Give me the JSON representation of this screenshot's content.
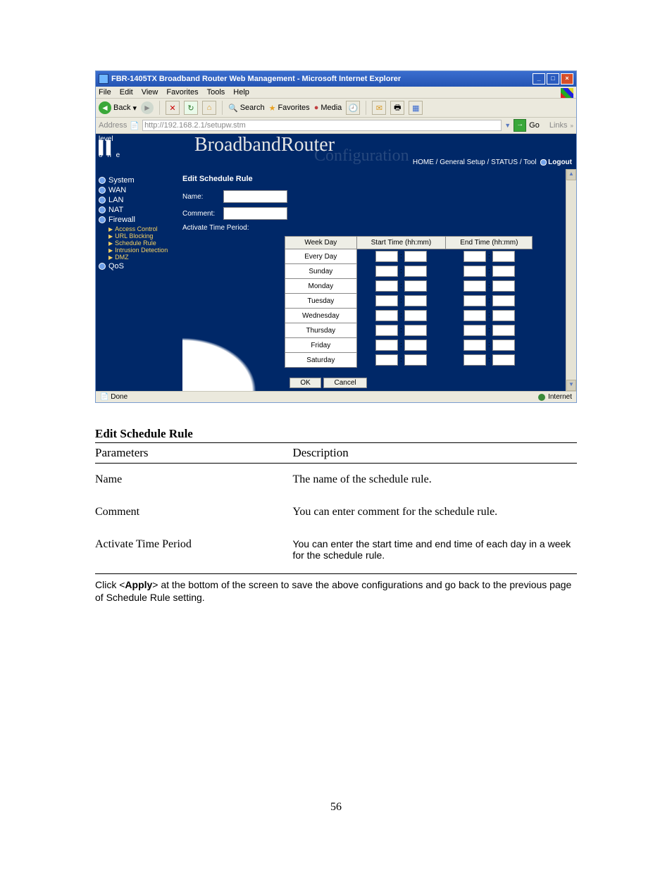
{
  "ie": {
    "title": "FBR-1405TX Broadband Router Web Management - Microsoft Internet Explorer",
    "menu": {
      "file": "File",
      "edit": "Edit",
      "view": "View",
      "favorites": "Favorites",
      "tools": "Tools",
      "help": "Help"
    },
    "toolbar": {
      "back": "Back",
      "search": "Search",
      "favorites": "Favorites",
      "media": "Media"
    },
    "address_label": "Address",
    "url": "http://192.168.2.1/setupw.stm",
    "go": "Go",
    "links": "Links",
    "status": "Done",
    "zone": "Internet"
  },
  "router": {
    "logo": {
      "level": "level",
      "one": "o n e"
    },
    "title_main": "BroadbandRouter",
    "title_sub": "Configuration",
    "top_links": {
      "home": "HOME",
      "general": "General Setup",
      "status": "STATUS",
      "tool": "Tool",
      "logout": "Logout"
    }
  },
  "sidebar": {
    "system": "System",
    "wan": "WAN",
    "lan": "LAN",
    "nat": "NAT",
    "firewall": "Firewall",
    "sub": {
      "access": "Access Control",
      "urlblock": "URL Blocking",
      "schedule": "Schedule Rule",
      "intrusion": "Intrusion Detection",
      "dmz": "DMZ"
    },
    "qos": "QoS"
  },
  "form": {
    "heading": "Edit Schedule Rule",
    "name_label": "Name:",
    "comment_label": "Comment:",
    "activate_label": "Activate Time Period:",
    "table_headers": {
      "weekday": "Week Day",
      "start": "Start Time (hh:mm)",
      "end": "End Time (hh:mm)"
    },
    "days": [
      "Every Day",
      "Sunday",
      "Monday",
      "Tuesday",
      "Wednesday",
      "Thursday",
      "Friday",
      "Saturday"
    ],
    "ok": "OK",
    "cancel": "Cancel"
  },
  "doc": {
    "heading": "Edit Schedule Rule",
    "th_param": "Parameters",
    "th_desc": "Description",
    "rows": [
      {
        "p": "Name",
        "d": "The name of the schedule rule."
      },
      {
        "p": "Comment",
        "d": "You can enter comment for the schedule rule."
      },
      {
        "p": "Activate Time Period",
        "d": "You can enter the start time and end time of each day in a week for the schedule rule."
      }
    ],
    "note_pre": "Click <",
    "note_bold": "Apply",
    "note_post": "> at the bottom of the screen to save the above configurations and go back to the previous page of Schedule Rule setting.",
    "page_num": "56"
  }
}
